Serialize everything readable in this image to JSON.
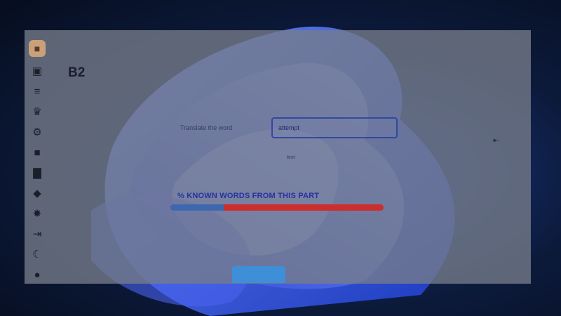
{
  "sidebar": {
    "logo": {
      "icon": "chest-logo-icon"
    },
    "items": [
      {
        "name": "sidebar-item-box",
        "icon": "box-icon",
        "glyph": "▣"
      },
      {
        "name": "sidebar-item-scroll",
        "icon": "scroll-icon",
        "glyph": "≡"
      },
      {
        "name": "sidebar-item-trophy",
        "icon": "trophy-icon",
        "glyph": "♛"
      },
      {
        "name": "sidebar-item-settings",
        "icon": "gear-icon",
        "glyph": "⚙"
      },
      {
        "name": "sidebar-item-profile",
        "icon": "id-card-icon",
        "glyph": "■"
      },
      {
        "name": "sidebar-item-leaderboard",
        "icon": "podium-icon",
        "glyph": "▇"
      },
      {
        "name": "sidebar-item-security",
        "icon": "shield-icon",
        "glyph": "◆"
      },
      {
        "name": "sidebar-item-bugs",
        "icon": "bug-icon",
        "glyph": "✸"
      },
      {
        "name": "sidebar-item-logout",
        "icon": "logout-icon",
        "glyph": "⇥"
      },
      {
        "name": "sidebar-item-theme",
        "icon": "moon-icon",
        "glyph": "☾"
      },
      {
        "name": "sidebar-item-github",
        "icon": "github-icon",
        "glyph": "●"
      }
    ]
  },
  "main": {
    "title": "B2",
    "translate_label": "Translate the word",
    "answer_value": "attempt",
    "hint": "test",
    "stats_heading": "% KNOWN WORDS FROM THIS PART",
    "known_fraction": 0.25
  },
  "colors": {
    "accent": "#3f8fd8",
    "progress_known": "#3f67b0",
    "progress_unknown": "#cc2d2d"
  }
}
